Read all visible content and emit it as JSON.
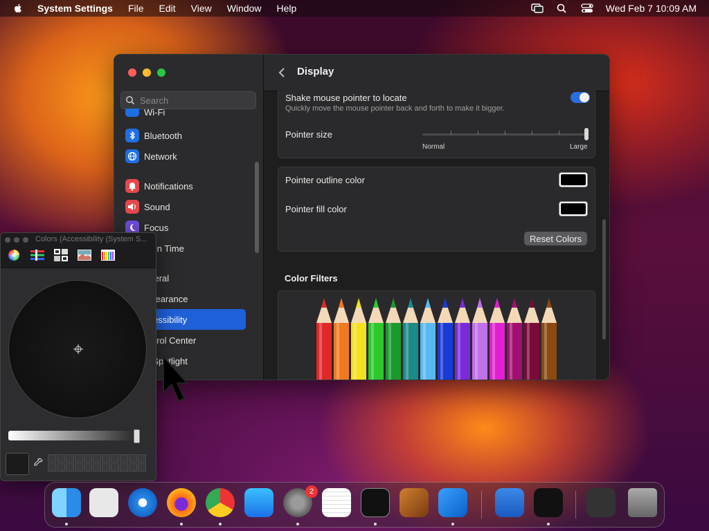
{
  "menubar": {
    "app": "System Settings",
    "menus": [
      "File",
      "Edit",
      "View",
      "Window",
      "Help"
    ],
    "clock": "Wed Feb 7  10:09 AM"
  },
  "sidebar": {
    "search_placeholder": "Search",
    "partial_top": "Wi-Fi",
    "items": [
      {
        "label": "Bluetooth",
        "color": "#1f6fe0"
      },
      {
        "label": "Network",
        "color": "#1f6fe0"
      },
      {
        "label": "Notifications",
        "color": "#e5484d"
      },
      {
        "label": "Sound",
        "color": "#e5484d"
      },
      {
        "label": "Focus",
        "color": "#6e4cd8"
      },
      {
        "label": "reen Time",
        "color": "#6e4cd8"
      },
      {
        "label": "eneral",
        "color": "#8a8a8a"
      },
      {
        "label": "ppearance",
        "color": "#222"
      },
      {
        "label": "ccessibility",
        "color": "#1f6fe0"
      },
      {
        "label": "ontrol Center",
        "color": "#8a8a8a"
      },
      {
        "label": "& Spotlight",
        "color": "#8a8a8a"
      }
    ]
  },
  "main": {
    "title": "Display",
    "shake": {
      "label": "Shake mouse pointer to locate",
      "sub": "Quickly move the mouse pointer back and forth to make it bigger.",
      "on": true
    },
    "pointer_size": {
      "label": "Pointer size",
      "min_label": "Normal",
      "max_label": "Large",
      "value": 1.0
    },
    "outline": {
      "label": "Pointer outline color"
    },
    "fill": {
      "label": "Pointer fill color"
    },
    "reset": "Reset Colors",
    "color_filters": "Color Filters"
  },
  "colors_panel": {
    "title": "Colors (Accessibility (System S..."
  },
  "dock": {
    "badge": "2",
    "icons": [
      "finder-icon",
      "launchpad-icon",
      "safari-icon",
      "firefox-icon",
      "chrome-icon",
      "app-store-icon",
      "system-settings-icon",
      "textedit-icon",
      "terminal-icon",
      "garageband-icon",
      "vscode-icon",
      "weather-icon",
      "apple-tv-icon",
      "screenshot-stack-icon",
      "trash-icon"
    ]
  },
  "theme": {
    "accent": "#2b6de0",
    "selection": "#1f5fd8"
  }
}
